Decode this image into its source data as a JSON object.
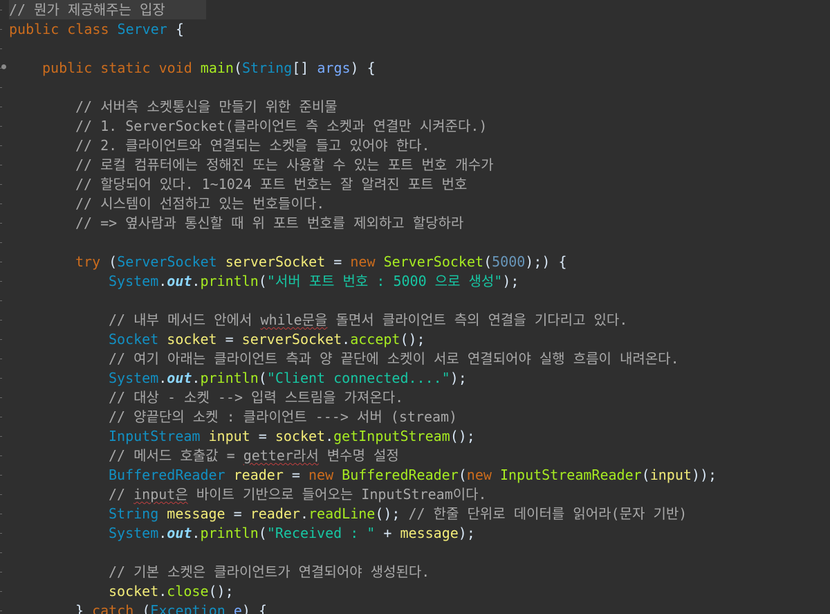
{
  "editor": {
    "lines": [
      {
        "indent": 0,
        "tokens": [
          {
            "t": "comment",
            "v": "// 뭔가 제공해주는 입장"
          }
        ],
        "highlight": true
      },
      {
        "indent": 0,
        "tokens": [
          {
            "t": "kw",
            "v": "public class "
          },
          {
            "t": "class",
            "v": "Server"
          },
          {
            "t": "plain",
            "v": " {"
          }
        ]
      },
      {
        "indent": 0,
        "tokens": []
      },
      {
        "indent": 1,
        "tokens": [
          {
            "t": "kw",
            "v": "public static void "
          },
          {
            "t": "method",
            "v": "main"
          },
          {
            "t": "plain",
            "v": "("
          },
          {
            "t": "type",
            "v": "String"
          },
          {
            "t": "plain",
            "v": "[] "
          },
          {
            "t": "param",
            "v": "args"
          },
          {
            "t": "plain",
            "v": ") {"
          }
        ]
      },
      {
        "indent": 0,
        "tokens": []
      },
      {
        "indent": 2,
        "tokens": [
          {
            "t": "comment",
            "v": "// 서버측 소켓통신을 만들기 위한 준비물"
          }
        ]
      },
      {
        "indent": 2,
        "tokens": [
          {
            "t": "comment",
            "v": "// 1. ServerSocket(클라이언트 측 소켓과 연결만 시켜준다.)"
          }
        ]
      },
      {
        "indent": 2,
        "tokens": [
          {
            "t": "comment",
            "v": "// 2. 클라이언트와 연결되는 소켓을 들고 있어야 한다."
          }
        ]
      },
      {
        "indent": 2,
        "tokens": [
          {
            "t": "comment",
            "v": "// 로컬 컴퓨터에는 정해진 또는 사용할 수 있는 포트 번호 개수가"
          }
        ]
      },
      {
        "indent": 2,
        "tokens": [
          {
            "t": "comment",
            "v": "// 할당되어 있다. 1~1024 포트 번호는 잘 알려진 포트 번호"
          }
        ]
      },
      {
        "indent": 2,
        "tokens": [
          {
            "t": "comment",
            "v": "// 시스템이 선점하고 있는 번호들이다."
          }
        ]
      },
      {
        "indent": 2,
        "tokens": [
          {
            "t": "comment",
            "v": "// => 옆사람과 통신할 때 위 포트 번호를 제외하고 할당하라"
          }
        ]
      },
      {
        "indent": 0,
        "tokens": []
      },
      {
        "indent": 2,
        "tokens": [
          {
            "t": "kw",
            "v": "try"
          },
          {
            "t": "plain",
            "v": " ("
          },
          {
            "t": "type",
            "v": "ServerSocket"
          },
          {
            "t": "plain",
            "v": " "
          },
          {
            "t": "var",
            "v": "serverSocket"
          },
          {
            "t": "plain",
            "v": " = "
          },
          {
            "t": "kw",
            "v": "new "
          },
          {
            "t": "method",
            "v": "ServerSocket"
          },
          {
            "t": "plain",
            "v": "("
          },
          {
            "t": "number",
            "v": "5000"
          },
          {
            "t": "plain",
            "v": ");) {"
          }
        ]
      },
      {
        "indent": 3,
        "tokens": [
          {
            "t": "type",
            "v": "System"
          },
          {
            "t": "plain",
            "v": "."
          },
          {
            "t": "static",
            "v": "out"
          },
          {
            "t": "plain",
            "v": "."
          },
          {
            "t": "method",
            "v": "println"
          },
          {
            "t": "plain",
            "v": "("
          },
          {
            "t": "string",
            "v": "\"서버 포트 번호 : 5000 으로 생성\""
          },
          {
            "t": "plain",
            "v": ");"
          }
        ]
      },
      {
        "indent": 0,
        "tokens": []
      },
      {
        "indent": 3,
        "tokens": [
          {
            "t": "comment",
            "v": "// 내부 메서드 안에서 "
          },
          {
            "t": "comment-squig",
            "v": "while문을"
          },
          {
            "t": "comment",
            "v": " 돌면서 클라이언트 측의 연결을 기다리고 있다."
          }
        ]
      },
      {
        "indent": 3,
        "tokens": [
          {
            "t": "type",
            "v": "Socket"
          },
          {
            "t": "plain",
            "v": " "
          },
          {
            "t": "var",
            "v": "socket"
          },
          {
            "t": "plain",
            "v": " = "
          },
          {
            "t": "var",
            "v": "serverSocket"
          },
          {
            "t": "plain",
            "v": "."
          },
          {
            "t": "method",
            "v": "accept"
          },
          {
            "t": "plain",
            "v": "();"
          }
        ]
      },
      {
        "indent": 3,
        "tokens": [
          {
            "t": "comment",
            "v": "// 여기 아래는 클라이언트 측과 양 끝단에 소켓이 서로 연결되어야 실행 흐름이 내려온다."
          }
        ]
      },
      {
        "indent": 3,
        "tokens": [
          {
            "t": "type",
            "v": "System"
          },
          {
            "t": "plain",
            "v": "."
          },
          {
            "t": "static",
            "v": "out"
          },
          {
            "t": "plain",
            "v": "."
          },
          {
            "t": "method",
            "v": "println"
          },
          {
            "t": "plain",
            "v": "("
          },
          {
            "t": "string",
            "v": "\"Client connected....\""
          },
          {
            "t": "plain",
            "v": ");"
          }
        ]
      },
      {
        "indent": 3,
        "tokens": [
          {
            "t": "comment",
            "v": "// 대상 - 소켓 --> 입력 스트림을 가져온다."
          }
        ]
      },
      {
        "indent": 3,
        "tokens": [
          {
            "t": "comment",
            "v": "// 양끝단의 소켓 : 클라이언트 ---> 서버 (stream)"
          }
        ]
      },
      {
        "indent": 3,
        "tokens": [
          {
            "t": "type",
            "v": "InputStream"
          },
          {
            "t": "plain",
            "v": " "
          },
          {
            "t": "var",
            "v": "input"
          },
          {
            "t": "plain",
            "v": " = "
          },
          {
            "t": "var",
            "v": "socket"
          },
          {
            "t": "plain",
            "v": "."
          },
          {
            "t": "method",
            "v": "getInputStream"
          },
          {
            "t": "plain",
            "v": "();"
          }
        ]
      },
      {
        "indent": 3,
        "tokens": [
          {
            "t": "comment",
            "v": "// 메서드 호출값 = "
          },
          {
            "t": "comment-squig",
            "v": "getter라서"
          },
          {
            "t": "comment",
            "v": " 변수명 설정"
          }
        ]
      },
      {
        "indent": 3,
        "tokens": [
          {
            "t": "type",
            "v": "BufferedReader"
          },
          {
            "t": "plain",
            "v": " "
          },
          {
            "t": "var",
            "v": "reader"
          },
          {
            "t": "plain",
            "v": " = "
          },
          {
            "t": "kw",
            "v": "new "
          },
          {
            "t": "method",
            "v": "BufferedReader"
          },
          {
            "t": "plain",
            "v": "("
          },
          {
            "t": "kw",
            "v": "new "
          },
          {
            "t": "method",
            "v": "InputStreamReader"
          },
          {
            "t": "plain",
            "v": "("
          },
          {
            "t": "var",
            "v": "input"
          },
          {
            "t": "plain",
            "v": "));"
          }
        ]
      },
      {
        "indent": 3,
        "tokens": [
          {
            "t": "comment",
            "v": "// "
          },
          {
            "t": "comment-squig",
            "v": "input은"
          },
          {
            "t": "comment",
            "v": " 바이트 기반으로 들어오는 InputStream이다."
          }
        ]
      },
      {
        "indent": 3,
        "tokens": [
          {
            "t": "type",
            "v": "String"
          },
          {
            "t": "plain",
            "v": " "
          },
          {
            "t": "var",
            "v": "message"
          },
          {
            "t": "plain",
            "v": " = "
          },
          {
            "t": "var",
            "v": "reader"
          },
          {
            "t": "plain",
            "v": "."
          },
          {
            "t": "method",
            "v": "readLine"
          },
          {
            "t": "plain",
            "v": "(); "
          },
          {
            "t": "comment",
            "v": "// 한줄 단위로 데이터를 읽어라(문자 기반)"
          }
        ]
      },
      {
        "indent": 3,
        "tokens": [
          {
            "t": "type",
            "v": "System"
          },
          {
            "t": "plain",
            "v": "."
          },
          {
            "t": "static",
            "v": "out"
          },
          {
            "t": "plain",
            "v": "."
          },
          {
            "t": "method",
            "v": "println"
          },
          {
            "t": "plain",
            "v": "("
          },
          {
            "t": "string",
            "v": "\"Received : \""
          },
          {
            "t": "plain",
            "v": " + "
          },
          {
            "t": "var",
            "v": "message"
          },
          {
            "t": "plain",
            "v": ");"
          }
        ]
      },
      {
        "indent": 0,
        "tokens": []
      },
      {
        "indent": 3,
        "tokens": [
          {
            "t": "comment",
            "v": "// 기본 소켓은 클라이언트가 연결되어야 생성된다."
          }
        ]
      },
      {
        "indent": 3,
        "tokens": [
          {
            "t": "var",
            "v": "socket"
          },
          {
            "t": "plain",
            "v": "."
          },
          {
            "t": "method",
            "v": "close"
          },
          {
            "t": "plain",
            "v": "();"
          }
        ]
      },
      {
        "indent": 2,
        "tokens": [
          {
            "t": "plain",
            "v": "} "
          },
          {
            "t": "kw",
            "v": "catch"
          },
          {
            "t": "plain",
            "v": " ("
          },
          {
            "t": "type",
            "v": "Exception"
          },
          {
            "t": "plain",
            "v": " "
          },
          {
            "t": "param",
            "v": "e"
          },
          {
            "t": "plain",
            "v": ") {"
          }
        ]
      }
    ]
  }
}
